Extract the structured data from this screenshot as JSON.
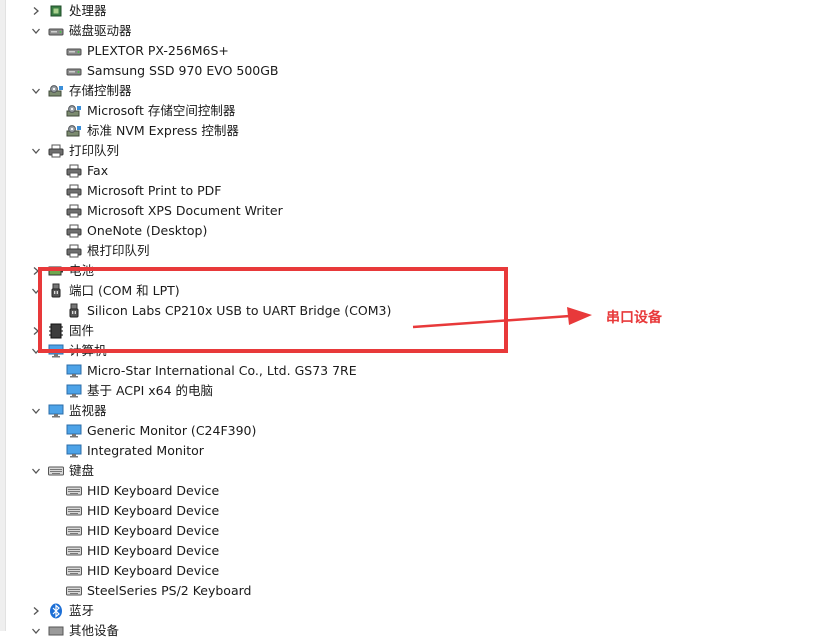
{
  "tree": {
    "rows": [
      {
        "type": "cat",
        "expanded": false,
        "icon": "processor-icon",
        "label": "处理器"
      },
      {
        "type": "cat",
        "expanded": true,
        "icon": "disk-drive-icon",
        "label": "磁盘驱动器"
      },
      {
        "type": "child",
        "icon": "disk-drive-icon",
        "label": "PLEXTOR PX-256M6S+"
      },
      {
        "type": "child",
        "icon": "disk-drive-icon",
        "label": "Samsung SSD 970 EVO 500GB"
      },
      {
        "type": "cat",
        "expanded": true,
        "icon": "storage-controller-icon",
        "label": "存储控制器"
      },
      {
        "type": "child",
        "icon": "storage-controller-icon",
        "label": "Microsoft 存储空间控制器"
      },
      {
        "type": "child",
        "icon": "storage-controller-icon",
        "label": "标准 NVM Express 控制器"
      },
      {
        "type": "cat",
        "expanded": true,
        "icon": "printer-icon",
        "label": "打印队列"
      },
      {
        "type": "child",
        "icon": "printer-icon",
        "label": "Fax"
      },
      {
        "type": "child",
        "icon": "printer-icon",
        "label": "Microsoft Print to PDF"
      },
      {
        "type": "child",
        "icon": "printer-icon",
        "label": "Microsoft XPS Document Writer"
      },
      {
        "type": "child",
        "icon": "printer-icon",
        "label": "OneNote (Desktop)"
      },
      {
        "type": "child",
        "icon": "printer-icon",
        "label": "根打印队列"
      },
      {
        "type": "cat",
        "expanded": false,
        "icon": "battery-icon",
        "label": "电池"
      },
      {
        "type": "cat",
        "expanded": true,
        "icon": "port-icon",
        "label": "端口 (COM 和 LPT)"
      },
      {
        "type": "child",
        "icon": "port-icon",
        "label": "Silicon Labs CP210x USB to UART Bridge (COM3)"
      },
      {
        "type": "cat",
        "expanded": false,
        "icon": "firmware-icon",
        "label": "固件"
      },
      {
        "type": "cat",
        "expanded": true,
        "icon": "computer-icon",
        "label": "计算机"
      },
      {
        "type": "child",
        "icon": "monitor-icon",
        "label": "Micro-Star International Co., Ltd. GS73 7RE"
      },
      {
        "type": "child",
        "icon": "monitor-icon",
        "label": "基于 ACPI x64 的电脑"
      },
      {
        "type": "cat",
        "expanded": true,
        "icon": "monitor-icon",
        "label": "监视器"
      },
      {
        "type": "child",
        "icon": "monitor-icon",
        "label": "Generic Monitor (C24F390)"
      },
      {
        "type": "child",
        "icon": "monitor-icon",
        "label": "Integrated Monitor"
      },
      {
        "type": "cat",
        "expanded": true,
        "icon": "keyboard-icon",
        "label": "键盘"
      },
      {
        "type": "child",
        "icon": "keyboard-icon",
        "label": "HID Keyboard Device"
      },
      {
        "type": "child",
        "icon": "keyboard-icon",
        "label": "HID Keyboard Device"
      },
      {
        "type": "child",
        "icon": "keyboard-icon",
        "label": "HID Keyboard Device"
      },
      {
        "type": "child",
        "icon": "keyboard-icon",
        "label": "HID Keyboard Device"
      },
      {
        "type": "child",
        "icon": "keyboard-icon",
        "label": "HID Keyboard Device"
      },
      {
        "type": "child",
        "icon": "keyboard-icon",
        "label": "SteelSeries PS/2 Keyboard"
      },
      {
        "type": "cat",
        "expanded": false,
        "icon": "bluetooth-icon",
        "label": "蓝牙"
      },
      {
        "type": "cat",
        "expanded": true,
        "icon": "other-devices-icon",
        "label": "其他设备"
      }
    ]
  },
  "annotation": {
    "label": "串口设备",
    "color": "#e8393a"
  }
}
